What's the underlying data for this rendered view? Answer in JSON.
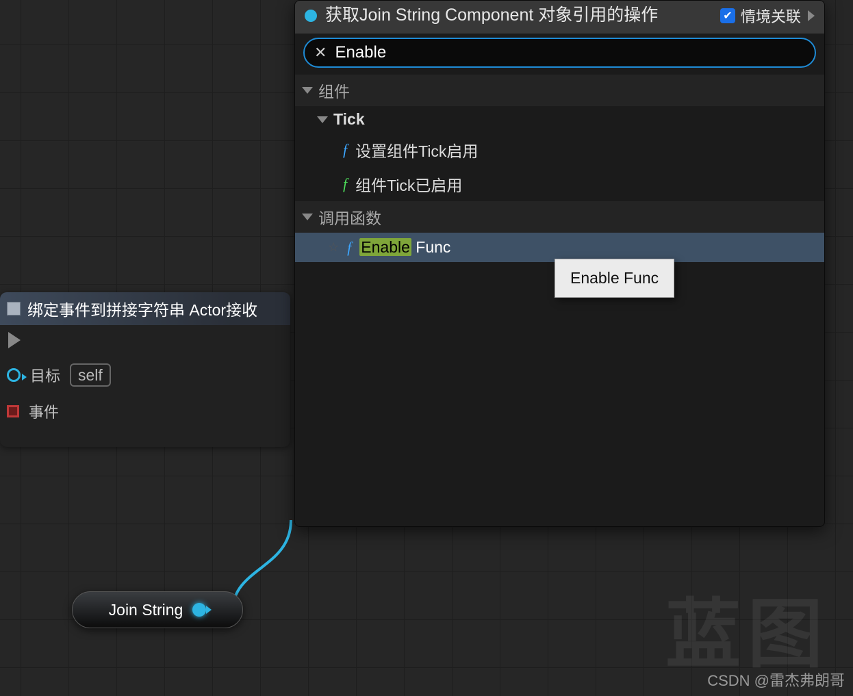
{
  "bind_node": {
    "title": "绑定事件到拼接字符串 Actor接收",
    "target_label": "目标",
    "target_value": "self",
    "event_label": "事件"
  },
  "join_node": {
    "label": "Join String"
  },
  "context_menu": {
    "title": "获取Join String Component 对象引用的操作",
    "context_toggle_label": "情境关联",
    "context_toggle_checked": true,
    "search_value": "Enable",
    "categories": {
      "components": {
        "label": "组件",
        "sub": {
          "tick": {
            "label": "Tick",
            "items": [
              {
                "label": "设置组件Tick启用",
                "color": "blue"
              },
              {
                "label": "组件Tick已启用",
                "color": "green"
              }
            ]
          }
        }
      },
      "call_function": {
        "label": "调用函数",
        "items": [
          {
            "label_prefix": "Enable",
            "label_suffix": " Func",
            "selected": true
          }
        ]
      }
    }
  },
  "tooltip": {
    "text": "Enable Func"
  },
  "watermark": {
    "cn": "蓝图",
    "csdn": "CSDN @雷杰弗朗哥"
  }
}
